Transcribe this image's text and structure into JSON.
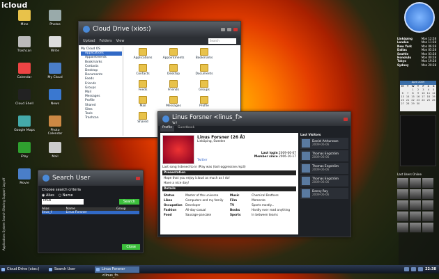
{
  "logo": "icloud",
  "desktop_icons": [
    {
      "label": "Mine",
      "color": "#e8c24a"
    },
    {
      "label": "Photos",
      "color": "#9aa"
    },
    {
      "label": "Trashcan",
      "color": "#bbb"
    },
    {
      "label": "Write",
      "color": "#ddd"
    },
    {
      "label": "Calendar",
      "color": "#e44"
    },
    {
      "label": "My Cloud",
      "color": "#4a7ec8"
    },
    {
      "label": "Cloud Shell",
      "color": "#222"
    },
    {
      "label": "News",
      "color": "#3a78d0"
    },
    {
      "label": "Google Maps",
      "color": "#4aa"
    },
    {
      "label": "Photo Calendar",
      "color": "#c84"
    },
    {
      "label": "iPlay",
      "color": "#2fa02f"
    },
    {
      "label": "Mail",
      "color": "#ccc"
    },
    {
      "label": "Movie",
      "color": "#4a7ec8"
    }
  ],
  "vertical_menu": "Applications  System  Search  Sharing  Support  Log off",
  "drive": {
    "caption": "Cloud Drive (xios:)",
    "toolbar": [
      "Upload",
      "Folders",
      "View"
    ],
    "search": "Search",
    "tree": [
      "My Cloud OS",
      "Applications",
      "Appointments",
      "Bookmarks",
      "Contacts",
      "Desktop",
      "Documents",
      "Feeds",
      "Friends",
      "Groups",
      "Mail",
      "Messages",
      "Profile",
      "Shared",
      "Sites",
      "Tools",
      "Trashcan"
    ],
    "files": [
      "Applications",
      "Appointments",
      "Bookmarks",
      "Contacts",
      "Desktop",
      "Documents",
      "Feeds",
      "Friends",
      "Groups",
      "Mail",
      "Messages",
      "Profile",
      "Shared",
      "Sites"
    ]
  },
  "search_user": {
    "caption": "Search User",
    "criteria_label": "Choose search criteria",
    "options": [
      "Alias",
      "Name"
    ],
    "query": "linus",
    "search_btn": "Search",
    "columns": [
      "Alias",
      "Name",
      "Group"
    ],
    "rows": [
      [
        "linus_f",
        "Linus Forsner",
        ""
      ]
    ],
    "close_btn": "Close"
  },
  "profile": {
    "caption": "Linus Forsner <linus_f>",
    "sub": "Yo!!",
    "tabs": [
      "Profile",
      "Guestbook"
    ],
    "name": "Linus Forsner (26 Å)",
    "location": "Linköping, Sweden",
    "last_login_label": "Last login",
    "last_login": "2009-06-07",
    "member_label": "Member since",
    "member": "2006-10-17",
    "twitter": "Twitter",
    "song": "Last song listened to in iPlay was (lost-aggressive.mp3)",
    "presentation_h": "Presentation",
    "presentation": [
      "Hope that you enjoy icloud as much as I do!",
      "Have a nice day!"
    ],
    "details_h": "Details",
    "details": [
      [
        "Status",
        "Master of the universe",
        "Music",
        "Chemical Brothers"
      ],
      [
        "Likes",
        "Computers and my family",
        "Film",
        "Memento"
      ],
      [
        "Occupation",
        "Developer",
        "TV",
        "Sports mostly..."
      ],
      [
        "Fashion",
        "All-day-casual",
        "Books",
        "Hardly ever read anything"
      ],
      [
        "Food",
        "Sausage-pancake",
        "Sports",
        "In between teams"
      ]
    ],
    "visitors_h": "Last Visitors",
    "visitors": [
      {
        "name": "Daniel Arthursson",
        "date": "2009-06-06"
      },
      {
        "name": "Thomas Engström",
        "date": "2009-06-06"
      },
      {
        "name": "Thomas Engström",
        "date": "2009-06-06"
      },
      {
        "name": "Thomas Engström",
        "date": "2009-06-06"
      },
      {
        "name": "Danny Roy",
        "date": "2009-06-06"
      }
    ]
  },
  "cities": [
    [
      "Linköping",
      "Mon 12:28"
    ],
    [
      "London",
      "Mon 11:28"
    ],
    [
      "New York",
      "Mon 06:28"
    ],
    [
      "Dallas",
      "Mon 05:28"
    ],
    [
      "Seattle",
      "Mon 03:28"
    ],
    [
      "Honolulu",
      "Mon 00:28"
    ],
    [
      "Tokyo",
      "Mon 19:28"
    ],
    [
      "Sydney",
      "Mon 20:28"
    ]
  ],
  "calendar": {
    "header": "April 2009",
    "days": [
      "M",
      "T",
      "W",
      "T",
      "F",
      "S",
      "S"
    ],
    "cells": [
      "",
      "",
      "1",
      "2",
      "3",
      "4",
      "5",
      "6",
      "7",
      "8",
      "9",
      "10",
      "11",
      "12",
      "13",
      "14",
      "15",
      "16",
      "17",
      "18",
      "19",
      "20",
      "21",
      "22",
      "23",
      "24",
      "25",
      "26",
      "27",
      "28",
      "29",
      "30",
      "",
      "",
      ""
    ]
  },
  "online_label": "Last Users Online",
  "taskbar": {
    "items": [
      "Cloud Drive (xios:)",
      "Search User",
      "Linus Forsner <linus_f>"
    ],
    "time": "22:38"
  }
}
